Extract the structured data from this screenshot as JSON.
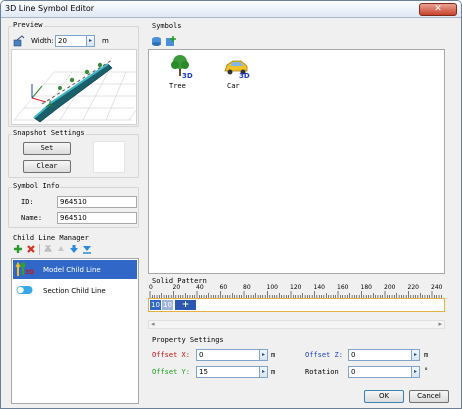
{
  "window": {
    "title": "3D Line Symbol Editor",
    "close_glyph": "✕"
  },
  "preview": {
    "heading": "Preview",
    "width_label": "Width:",
    "width_value": "20",
    "width_unit": "m",
    "spin_glyph": "▸"
  },
  "snapshot": {
    "heading": "Snapshot Settings",
    "set_label": "Set",
    "clear_label": "Clear"
  },
  "symbol_info": {
    "heading": "Symbol Info",
    "id_label": "ID:",
    "id_value": "964510",
    "name_label": "Name:",
    "name_value": "964510"
  },
  "child_manager": {
    "heading": "Child Line Manager",
    "items": [
      {
        "label": "Model Child Line",
        "selected": true
      },
      {
        "label": "Section Child Line",
        "selected": false
      }
    ],
    "model_badge": "3D"
  },
  "symbols": {
    "heading": "Symbols",
    "items": [
      {
        "label": "Tree",
        "badge": "3D"
      },
      {
        "label": "Car",
        "badge": "3D"
      }
    ]
  },
  "solid_pattern": {
    "heading": "Solid Pattern",
    "ticks": [
      "0",
      "20",
      "40",
      "60",
      "80",
      "100",
      "120",
      "140",
      "160",
      "180",
      "200",
      "220",
      "240"
    ],
    "cells": [
      "10",
      "10"
    ],
    "add_label": "+",
    "scroll_left": "◂",
    "scroll_right": "▸"
  },
  "property": {
    "heading": "Property Settings",
    "offset_x_label": "Offset X:",
    "offset_x_value": "0",
    "offset_x_unit": "m",
    "offset_y_label": "Offset Y:",
    "offset_y_value": "15",
    "offset_y_unit": "m",
    "offset_z_label": "Offset Z:",
    "offset_z_value": "0",
    "offset_z_unit": "m",
    "rotation_label": "Rotation",
    "rotation_value": "0",
    "rotation_unit": "°",
    "spin_glyph": "▸"
  },
  "footer": {
    "ok_label": "OK",
    "cancel_label": "Cancel"
  },
  "colors": {
    "selection": "#3168c8",
    "offset_x": "#d01010",
    "offset_y": "#18a018",
    "offset_z": "#1a3fc8",
    "pipe": "#1a5f6a"
  }
}
